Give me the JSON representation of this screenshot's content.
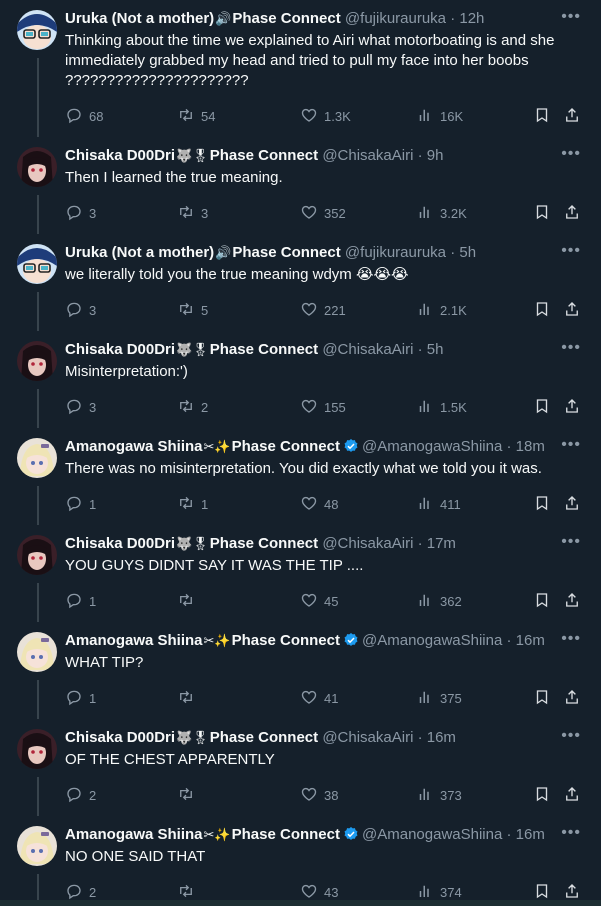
{
  "colors": {
    "background": "#15202b",
    "text": "#f7f9f9",
    "muted": "#8b98a5",
    "verified": "#1d9bf0",
    "line": "#38444d"
  },
  "tweets": [
    {
      "name": "Uruka (Not a mother)",
      "badge": "🔊",
      "org": "Phase Connect",
      "handle": "@fujikurauruka",
      "time": "12h",
      "avatar": "uruka",
      "text": "Thinking about the time we explained to Airi what motorboating is and she immediately grabbed my head and tried to pull my face into her boobs ??????????????????????",
      "replies": "68",
      "retweets": "54",
      "likes": "1.3K",
      "views": "16K"
    },
    {
      "name": "Chisaka D00Dri",
      "badge": "🐺🎖",
      "org": "Phase Connect",
      "handle": "@ChisakaAiri",
      "time": "9h",
      "avatar": "chisaka",
      "text": "Then I learned the true meaning.",
      "replies": "3",
      "retweets": "3",
      "likes": "352",
      "views": "3.2K"
    },
    {
      "name": "Uruka (Not a mother)",
      "badge": "🔊",
      "org": "Phase Connect",
      "handle": "@fujikurauruka",
      "time": "5h",
      "avatar": "uruka",
      "text": "we literally told you the true meaning wdym 😭😭😭",
      "replies": "3",
      "retweets": "5",
      "likes": "221",
      "views": "2.1K"
    },
    {
      "name": "Chisaka D00Dri",
      "badge": "🐺🎖",
      "org": "Phase Connect",
      "handle": "@ChisakaAiri",
      "time": "5h",
      "avatar": "chisaka",
      "text": "Misinterpretation:')",
      "replies": "3",
      "retweets": "2",
      "likes": "155",
      "views": "1.5K"
    },
    {
      "name": "Amanogawa Shiina",
      "badge": "✂✨",
      "org": "Phase Connect",
      "handle": "@AmanogawaShiina",
      "time": "18m",
      "avatar": "shiina",
      "text": "There was no misinterpretation. You did exactly what we told you it was.",
      "replies": "1",
      "retweets": "1",
      "likes": "48",
      "views": "411"
    },
    {
      "name": "Chisaka D00Dri",
      "badge": "🐺🎖",
      "org": "Phase Connect",
      "handle": "@ChisakaAiri",
      "time": "17m",
      "avatar": "chisaka",
      "text": "YOU GUYS DIDNT SAY IT WAS THE TIP ....",
      "replies": "1",
      "retweets": "",
      "likes": "45",
      "views": "362"
    },
    {
      "name": "Amanogawa Shiina",
      "badge": "✂✨",
      "org": "Phase Connect",
      "handle": "@AmanogawaShiina",
      "time": "16m",
      "avatar": "shiina",
      "text": "WHAT TIP?",
      "replies": "1",
      "retweets": "",
      "likes": "41",
      "views": "375"
    },
    {
      "name": "Chisaka D00Dri",
      "badge": "🐺🎖",
      "org": "Phase Connect",
      "handle": "@ChisakaAiri",
      "time": "16m",
      "avatar": "chisaka",
      "text": "OF THE CHEST APPARENTLY",
      "replies": "2",
      "retweets": "",
      "likes": "38",
      "views": "373"
    },
    {
      "name": "Amanogawa Shiina",
      "badge": "✂✨",
      "org": "Phase Connect",
      "handle": "@AmanogawaShiina",
      "time": "16m",
      "avatar": "shiina",
      "text": "NO ONE SAID THAT",
      "replies": "2",
      "retweets": "",
      "likes": "43",
      "views": "374"
    }
  ]
}
